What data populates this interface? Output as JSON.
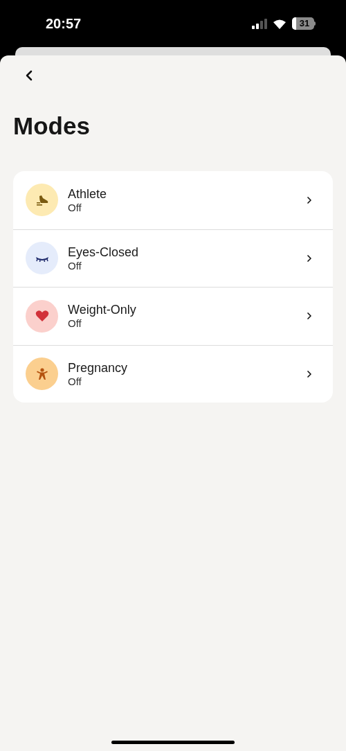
{
  "status_bar": {
    "time": "20:57",
    "battery": "31"
  },
  "title": "Modes",
  "modes": [
    {
      "kind": "shoe",
      "name": "Athlete",
      "status": "Off"
    },
    {
      "kind": "eye",
      "name": "Eyes-Closed",
      "status": "Off"
    },
    {
      "kind": "heart",
      "name": "Weight-Only",
      "status": "Off"
    },
    {
      "kind": "person",
      "name": "Pregnancy",
      "status": "Off"
    }
  ]
}
